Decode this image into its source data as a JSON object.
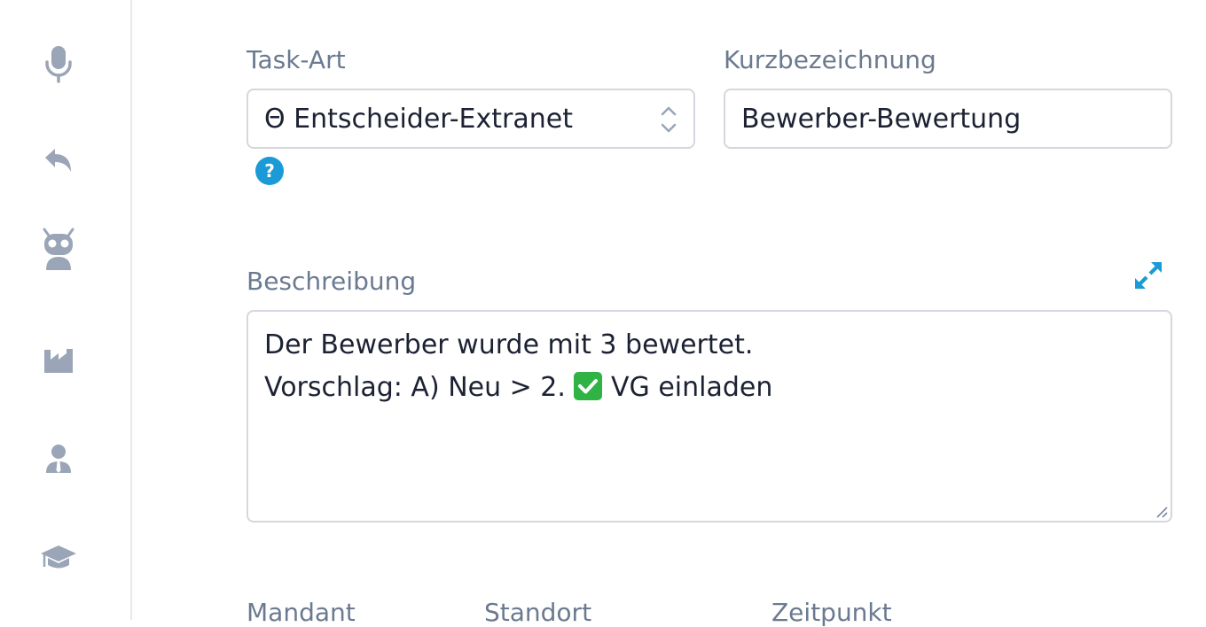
{
  "sidebar": {
    "items": [
      {
        "icon": "microphone-icon"
      },
      {
        "icon": "reply-icon"
      },
      {
        "icon": "robot-icon"
      },
      {
        "icon": "factory-icon"
      },
      {
        "icon": "user-tie-icon"
      },
      {
        "icon": "graduation-cap-icon"
      }
    ]
  },
  "form": {
    "task_type": {
      "label": "Task-Art",
      "value": "Θ Entscheider-Extranet"
    },
    "short_name": {
      "label": "Kurzbezeichnung",
      "value": "Bewerber-Bewertung"
    },
    "description": {
      "label": "Beschreibung",
      "line1": "Der Bewerber wurde mit 3 bewertet.",
      "line2_before": "Vorschlag: A) Neu > 2.",
      "line2_after": "VG einladen"
    },
    "bottom_labels": {
      "client": "Mandant",
      "location": "Standort",
      "time": "Zeitpunkt"
    }
  },
  "colors": {
    "accent": "#1a9ad6",
    "icon_gray": "#9aa5b8",
    "label_gray": "#6b7a90",
    "check_green": "#2fb344"
  }
}
